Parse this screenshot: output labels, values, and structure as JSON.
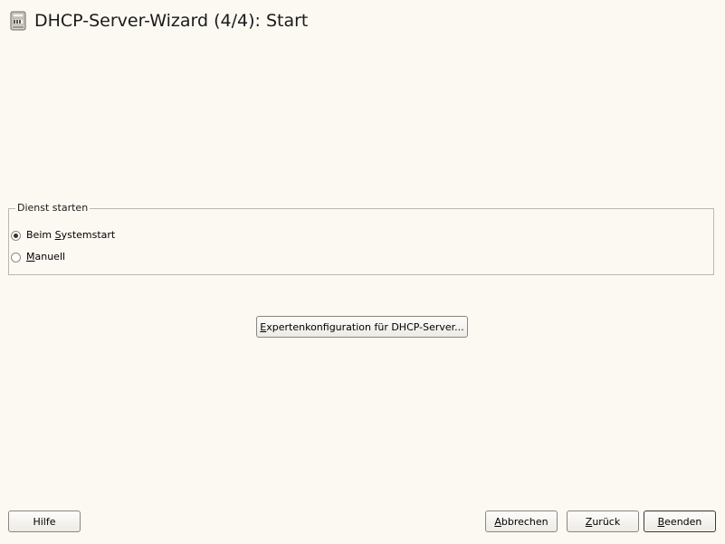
{
  "window": {
    "title": "DHCP-Server-Wizard (4/4): Start",
    "icon": "dhcp-server-icon"
  },
  "service_group": {
    "legend": "Dienst starten",
    "options": [
      {
        "label": "Beim Systemstart",
        "selected": true
      },
      {
        "label": "Manuell",
        "selected": false
      }
    ]
  },
  "expert_button": {
    "label": "Expertenkonfiguration für DHCP-Server..."
  },
  "footer": {
    "help_label": "Hilfe",
    "cancel_label": "Abbrechen",
    "back_label": "Zurück",
    "finish_label": "Beenden"
  }
}
